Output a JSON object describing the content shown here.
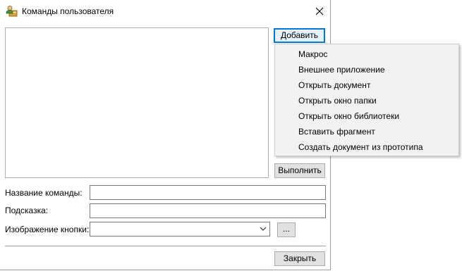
{
  "window": {
    "title": "Команды пользователя",
    "app_icon": "user-commands-icon",
    "close_icon": "close-icon"
  },
  "buttons": {
    "add": "Добавить",
    "run": "Выполнить",
    "close": "Закрыть",
    "browse": "..."
  },
  "labels": {
    "command_name": "Название команды:",
    "tooltip": "Подсказка:",
    "button_image": "Изображение кнопки:"
  },
  "fields": {
    "command_name_value": "",
    "tooltip_value": "",
    "button_image_selected": ""
  },
  "add_menu": {
    "items": [
      {
        "label": "Макрос"
      },
      {
        "label": "Внешнее приложение"
      },
      {
        "label": "Открыть документ"
      },
      {
        "label": "Открыть окно папки"
      },
      {
        "label": "Открыть окно библиотеки"
      },
      {
        "label": "Вставить фрагмент"
      },
      {
        "label": "Создать документ из прототипа"
      }
    ]
  },
  "colors": {
    "focus_accent": "#0078d7",
    "button_face": "#e1e1e1",
    "menu_background": "#f2f2f2"
  }
}
